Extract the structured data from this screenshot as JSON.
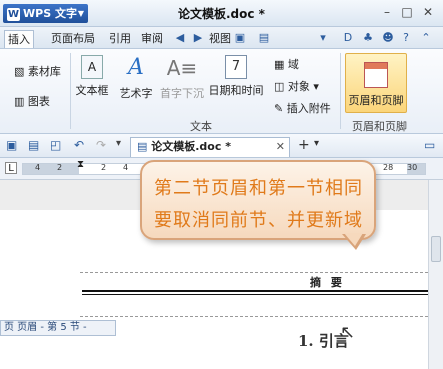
{
  "app": {
    "name": "WPS 文字",
    "doc_title": "论文模板.doc *"
  },
  "menu": {
    "tabs": [
      "插入",
      "页面布局",
      "引用",
      "审阅",
      "视图",
      "章节",
      "开发工具"
    ]
  },
  "ribbon": {
    "left_items": [
      "素材库",
      "图表"
    ],
    "buttons": [
      "文本框",
      "艺术字",
      "首字下沉",
      "日期和时间"
    ],
    "small": [
      "域",
      "对象",
      "插入附件"
    ],
    "group_text": "文本",
    "header_footer": "页眉和页脚",
    "group_hf": "页眉和页脚"
  },
  "doc_tab": {
    "label": "论文模板.doc *"
  },
  "ruler": {
    "numbers": [
      "4",
      "2",
      "2",
      "4",
      "6",
      "8",
      "10",
      "12",
      "14",
      "16",
      "18",
      "20",
      "22",
      "24",
      "26",
      "28",
      "30"
    ]
  },
  "callout": {
    "line1": "第二节页眉和第一节相同",
    "line2": "要取消同前节、并更新域"
  },
  "page": {
    "header_text": "摘  要",
    "header_label": "页 页眉 - 第 5 节 -",
    "heading": "1.  引言"
  }
}
